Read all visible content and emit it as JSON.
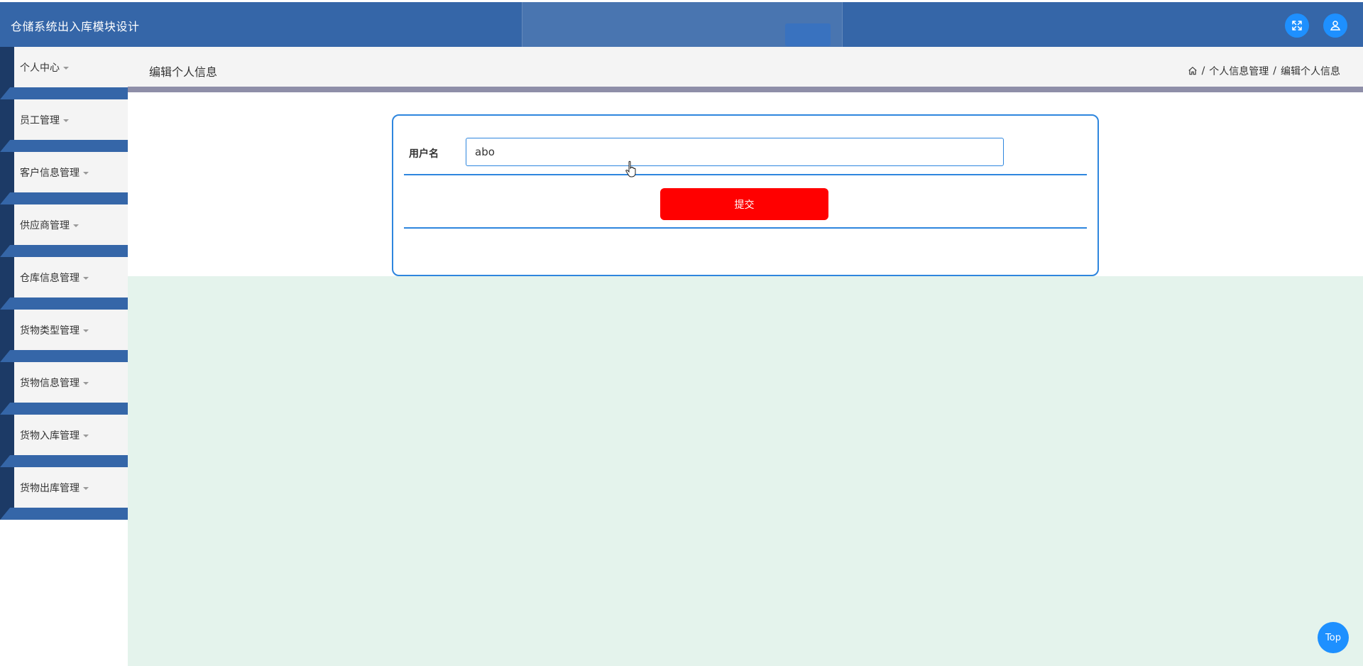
{
  "header": {
    "title": "仓储系统出入库模块设计",
    "fullscreen_icon": "fullscreen-icon",
    "user_icon": "user-icon"
  },
  "sidebar": {
    "items": [
      {
        "label": "个人中心"
      },
      {
        "label": "员工管理"
      },
      {
        "label": "客户信息管理"
      },
      {
        "label": "供应商管理"
      },
      {
        "label": "仓库信息管理"
      },
      {
        "label": "货物类型管理"
      },
      {
        "label": "货物信息管理"
      },
      {
        "label": "货物入库管理"
      },
      {
        "label": "货物出库管理"
      }
    ]
  },
  "main": {
    "page_title": "编辑个人信息",
    "breadcrumb": {
      "sep": "/",
      "items": [
        "个人信息管理",
        "编辑个人信息"
      ]
    },
    "form": {
      "username_label": "用户名",
      "username_value": "abo",
      "submit_label": "提交"
    }
  },
  "top_button": "Top",
  "colors": {
    "header": "#3566a8",
    "sidebar_strip": "#1c3a66",
    "accent": "#2e86de",
    "submit": "#ff0000",
    "round_button": "#1e90ff",
    "content_bg": "#e4f3ec"
  }
}
